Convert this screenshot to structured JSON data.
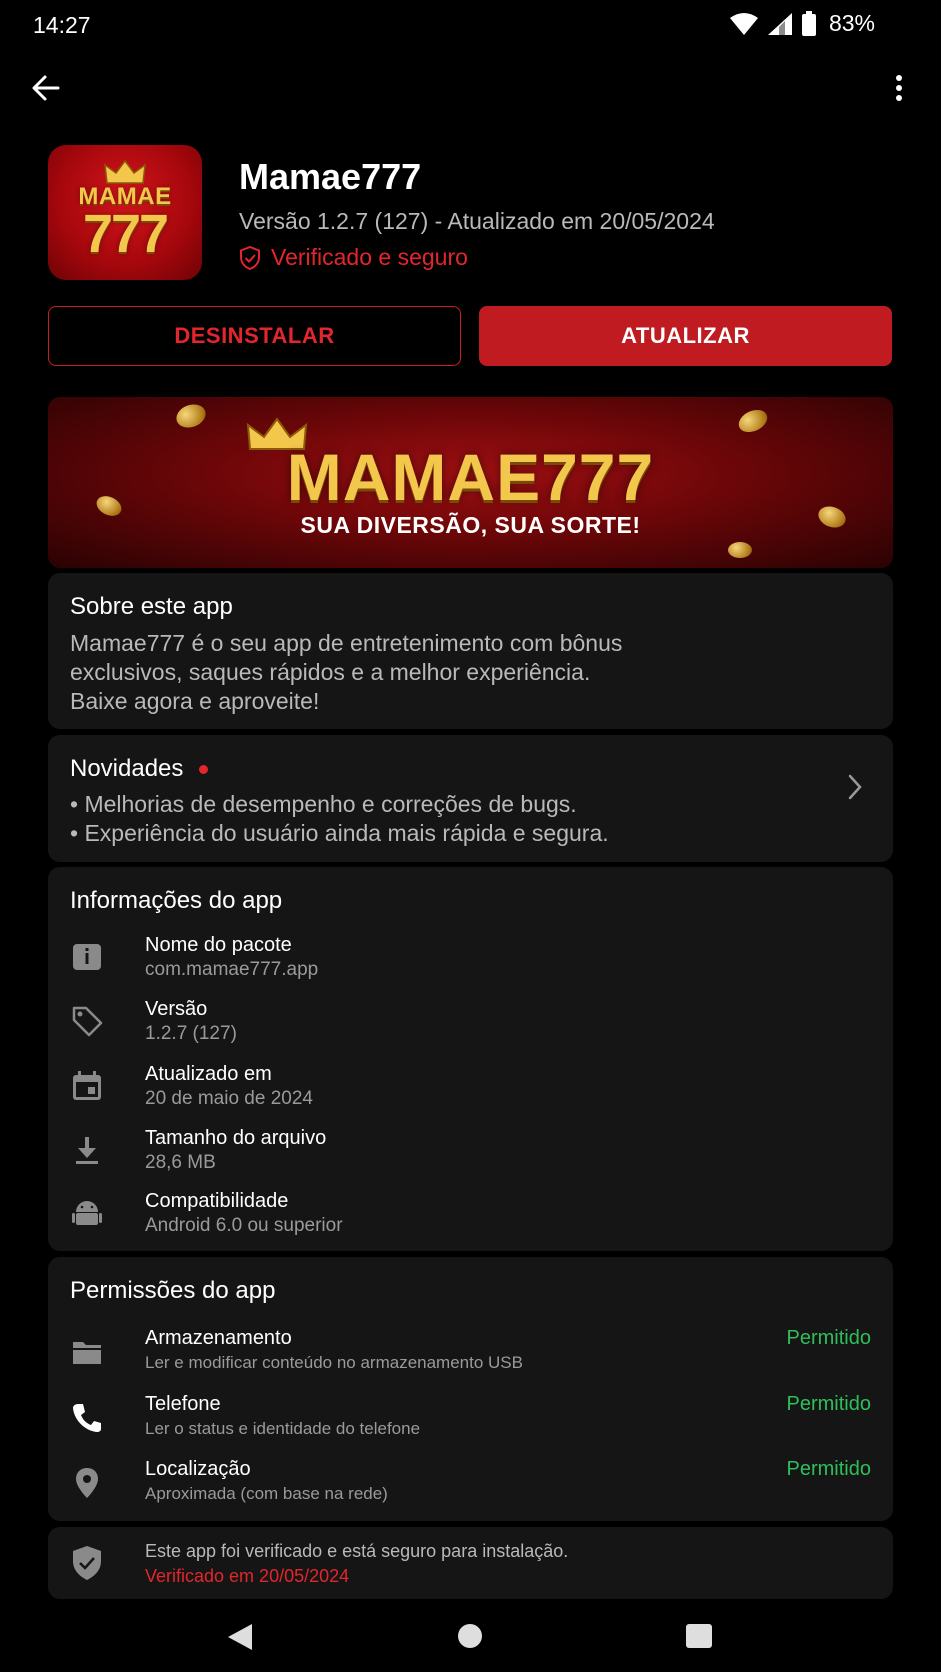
{
  "status_bar": {
    "time": "14:27",
    "battery": "83%"
  },
  "app": {
    "icon_text_top": "MAMAE",
    "icon_text_bottom": "777",
    "name": "Mamae777",
    "version_line": "Versão 1.2.7 (127) - Atualizado em 20/05/2024",
    "verified_label": "Verificado e seguro"
  },
  "actions": {
    "uninstall_label": "DESINSTALAR",
    "update_label": "ATUALIZAR"
  },
  "banner": {
    "title": "MAMAE777",
    "subtitle": "SUA DIVERSÃO, SUA SORTE!"
  },
  "about": {
    "title": "Sobre este app",
    "lines": [
      "Mamae777 é o seu app de entretenimento com bônus",
      "exclusivos, saques rápidos e a melhor experiência.",
      "Baixe agora e aproveite!"
    ]
  },
  "news": {
    "title": "Novidades",
    "items": [
      "• Melhorias de desempenho e correções de bugs.",
      "• Experiência do usuário ainda mais rápida e segura."
    ]
  },
  "info": {
    "title": "Informações do app",
    "rows": [
      {
        "icon": "info-icon",
        "label": "Nome do pacote",
        "value": "com.mamae777.app"
      },
      {
        "icon": "tag-icon",
        "label": "Versão",
        "value": "1.2.7 (127)"
      },
      {
        "icon": "calendar-icon",
        "label": "Atualizado em",
        "value": "20 de maio de 2024"
      },
      {
        "icon": "download-icon",
        "label": "Tamanho do arquivo",
        "value": "28,6 MB"
      },
      {
        "icon": "android-icon",
        "label": "Compatibilidade",
        "value": "Android 6.0 ou superior"
      }
    ]
  },
  "permissions": {
    "title": "Permissões do app",
    "rows": [
      {
        "icon": "folder-icon",
        "label": "Armazenamento",
        "value": "Ler e modificar conteúdo no armazenamento USB",
        "status": "Permitido"
      },
      {
        "icon": "phone-icon",
        "label": "Telefone",
        "value": "Ler o status e identidade do telefone",
        "status": "Permitido"
      },
      {
        "icon": "location-icon",
        "label": "Localização",
        "value": "Aproximada (com base na rede)",
        "status": "Permitido"
      }
    ]
  },
  "footer": {
    "text": "Este app foi verificado e está seguro para instalação.",
    "date": "Verificado em 20/05/2024"
  },
  "colors": {
    "accent": "#c01b20",
    "accent_text": "#e3262c",
    "success": "#2fbf5a",
    "card": "#151515",
    "gold": "#f3c64c"
  }
}
